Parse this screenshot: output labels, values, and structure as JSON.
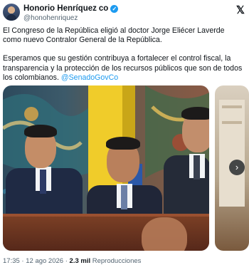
{
  "post": {
    "author_name": "Honorio Henríquez",
    "author_badge": "co",
    "handle": "@honohenriquez",
    "paragraph1": "El Congreso de la República eligió al doctor Jorge Eliécer Laverde como nuevo Contralor General de la República.",
    "paragraph2": "Esperamos que su gestión contribuya a fortalecer el control fiscal, la transparencia y la protección de los recursos públicos que son de todos los colombianos.",
    "mention": "@SenadoGovCo",
    "time": "17:35",
    "separator": "·",
    "date": "12 ago 2026",
    "views_count": "2.3 mil",
    "views_label": "Reproducciones"
  },
  "icons": {
    "verified": "verified-badge-icon",
    "logo": "x-logo-icon",
    "next": "chevron-right-icon"
  },
  "colors": {
    "accent": "#1d9bf0",
    "text": "#0f1419",
    "secondary": "#536471"
  }
}
